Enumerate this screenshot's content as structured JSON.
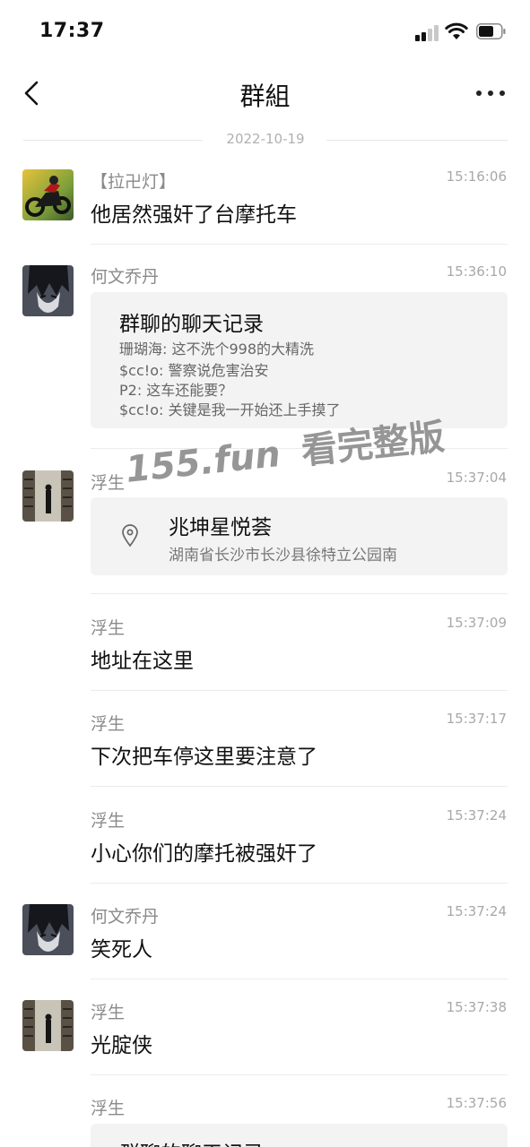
{
  "status_bar": {
    "time": "17:37"
  },
  "header": {
    "title": "群組"
  },
  "date_divider": "2022-10-19",
  "messages": [
    {
      "sender": "【拉卍灯】",
      "time": "15:16:06",
      "text": "他居然强奸了台摩托车",
      "avatar": "motorcycle-avatar"
    },
    {
      "sender": "何文乔丹",
      "time": "15:36:10",
      "avatar": "anime-boy-avatar",
      "card": {
        "title": "群聊的聊天记录",
        "lines": [
          "珊瑚海: 这不洗个998的大精洗",
          "$cc!o: 警察说危害治安",
          "P2: 这车还能要？",
          "$cc!o: 关键是我一开始还上手摸了"
        ]
      }
    },
    {
      "sender": "浮生",
      "time": "15:37:04",
      "avatar": "warehouse-avatar",
      "location": {
        "name": "兆坤星悦荟",
        "address": "湖南省长沙市长沙县徐特立公园南"
      }
    },
    {
      "sender": "浮生",
      "time": "15:37:09",
      "text": "地址在这里"
    },
    {
      "sender": "浮生",
      "time": "15:37:17",
      "text": "下次把车停这里要注意了"
    },
    {
      "sender": "浮生",
      "time": "15:37:24",
      "text": "小心你们的摩托被强奸了"
    },
    {
      "sender": "何文乔丹",
      "time": "15:37:24",
      "text": "笑死人",
      "avatar": "anime-boy-avatar"
    },
    {
      "sender": "浮生",
      "time": "15:37:38",
      "text": "光腚侠",
      "avatar": "warehouse-avatar"
    },
    {
      "sender": "浮生",
      "time": "15:37:56",
      "card_partial_title": "群聊的聊天记录"
    }
  ],
  "watermark": {
    "en": "155.fun",
    "zh": "看完整版"
  },
  "colors": {
    "background": "#ffffff",
    "card": "#f3f3f3",
    "meta_text": "#8a8a8a",
    "divider": "#ececec"
  }
}
